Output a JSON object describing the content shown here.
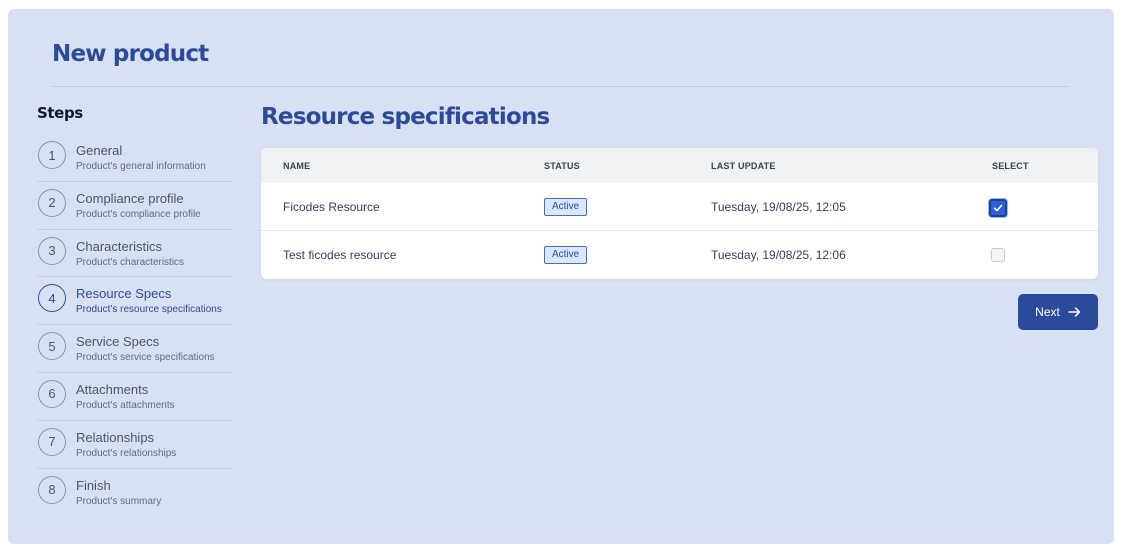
{
  "page": {
    "title": "New product"
  },
  "steps": {
    "heading": "Steps",
    "items": [
      {
        "number": "1",
        "title": "General",
        "subtitle": "Product's general information",
        "active": false
      },
      {
        "number": "2",
        "title": "Compliance profile",
        "subtitle": "Product's compliance profile",
        "active": false
      },
      {
        "number": "3",
        "title": "Characteristics",
        "subtitle": "Product's characteristics",
        "active": false
      },
      {
        "number": "4",
        "title": "Resource Specs",
        "subtitle": "Product's resource specifications",
        "active": true
      },
      {
        "number": "5",
        "title": "Service Specs",
        "subtitle": "Product's service specifications",
        "active": false
      },
      {
        "number": "6",
        "title": "Attachments",
        "subtitle": "Product's attachments",
        "active": false
      },
      {
        "number": "7",
        "title": "Relationships",
        "subtitle": "Product's relationships",
        "active": false
      },
      {
        "number": "8",
        "title": "Finish",
        "subtitle": "Product's summary",
        "active": false
      }
    ]
  },
  "main": {
    "section_title": "Resource specifications",
    "table": {
      "columns": [
        "NAME",
        "STATUS",
        "LAST UPDATE",
        "SELECT"
      ],
      "rows": [
        {
          "name": "Ficodes Resource",
          "status": "Active",
          "last_update": "Tuesday, 19/08/25, 12:05",
          "selected": true
        },
        {
          "name": "Test ficodes resource",
          "status": "Active",
          "last_update": "Tuesday, 19/08/25, 12:06",
          "selected": false
        }
      ]
    },
    "next_label": "Next"
  },
  "colors": {
    "accent": "#2c4a9a",
    "panel_bg": "#d8e1f3",
    "badge_border": "#3b6fd4",
    "checkbox_checked": "#2d5fdc"
  },
  "icons": {
    "next": "arrow-right-icon",
    "check": "check-icon"
  }
}
